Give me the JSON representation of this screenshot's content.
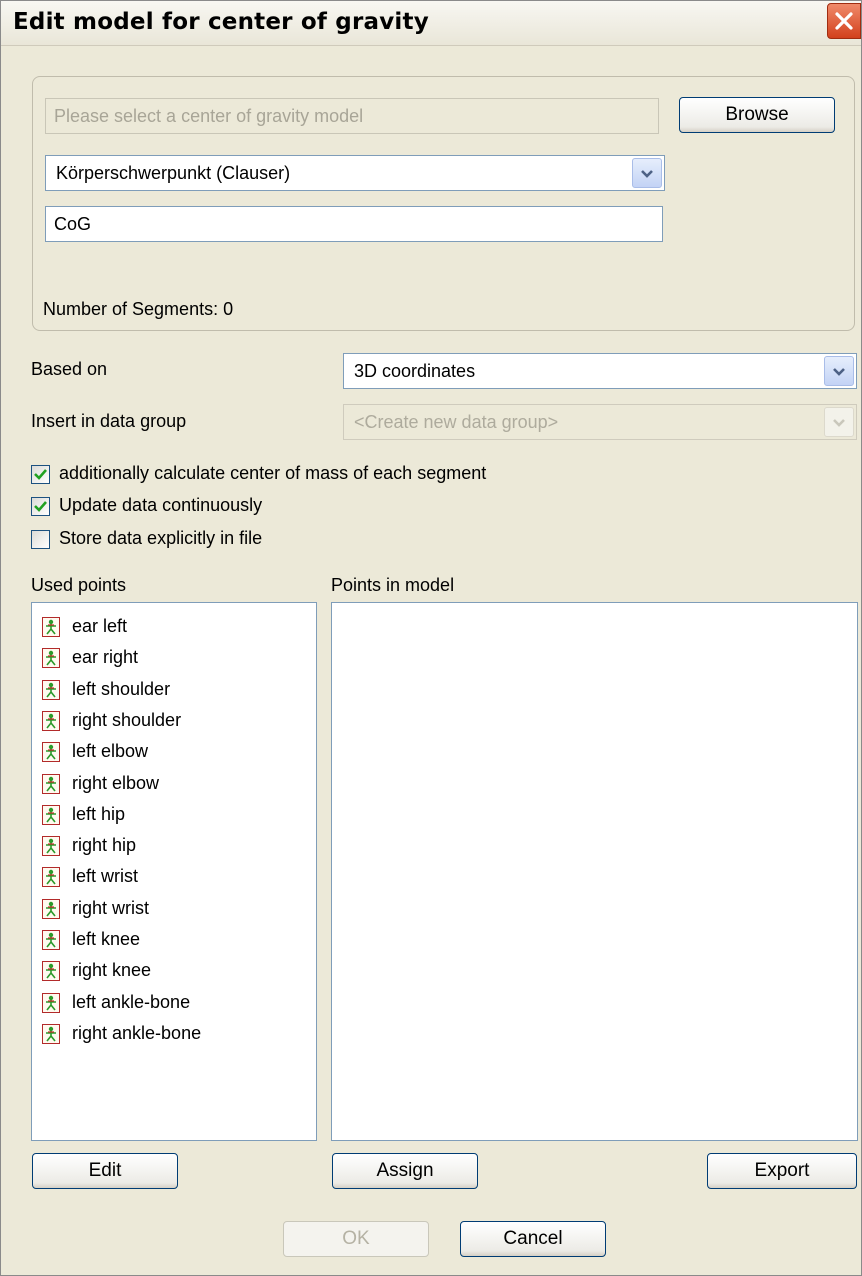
{
  "window": {
    "title": "Edit model for center of gravity"
  },
  "model": {
    "file_placeholder": "Please select a center of gravity model",
    "browse_label": "Browse",
    "model_select_value": "Körperschwerpunkt (Clauser)",
    "name_value": "CoG",
    "segments_text": "Number of Segments: 0"
  },
  "settings": {
    "based_on_label": "Based on",
    "based_on_value": "3D coordinates",
    "insert_label": "Insert in data group",
    "insert_value": "<Create new data group>"
  },
  "options": [
    {
      "label": "additionally calculate center of mass of each segment",
      "checked": true
    },
    {
      "label": "Update data continuously",
      "checked": true
    },
    {
      "label": "Store data explicitly in file",
      "checked": false
    }
  ],
  "used_points": {
    "header": "Used points",
    "items": [
      "ear left",
      "ear right",
      "left shoulder",
      "right shoulder",
      "left elbow",
      "right elbow",
      "left hip",
      "right hip",
      "left wrist",
      "right wrist",
      "left knee",
      "right knee",
      "left ankle-bone",
      "right ankle-bone"
    ]
  },
  "model_points": {
    "header": "Points in model",
    "items": []
  },
  "buttons": {
    "edit": "Edit",
    "assign": "Assign",
    "export": "Export",
    "ok": "OK",
    "cancel": "Cancel"
  },
  "icons": {
    "close": "close-icon",
    "dropdown": "chevron-down-icon",
    "point": "person-point-icon",
    "check": "checkmark-icon"
  },
  "colors": {
    "dialog_bg": "#ece9d8",
    "close_button": "#d2401c",
    "field_border": "#7f9db9",
    "button_border": "#003c74",
    "check_green": "#21a121"
  }
}
